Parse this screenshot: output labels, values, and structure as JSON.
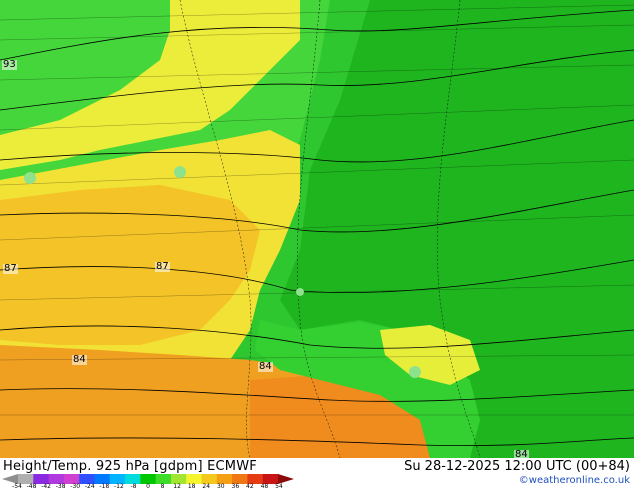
{
  "map": {
    "contour_labels": [
      "93",
      "87",
      "87",
      "84",
      "84",
      "84"
    ]
  },
  "footer": {
    "title_left": "Height/Temp. 925 hPa [gdpm] ECMWF",
    "title_right": "Su 28-12-2025 12:00 UTC (00+84)",
    "credit": "©weatheronline.co.uk"
  },
  "scale": {
    "ticks": [
      "-54",
      "-48",
      "-42",
      "-38",
      "-30",
      "-24",
      "-18",
      "-12",
      "-8",
      "0",
      "8",
      "12",
      "18",
      "24",
      "30",
      "36",
      "42",
      "48",
      "54"
    ],
    "colors": [
      "#8e8e8e",
      "#b0b0b0",
      "#8a2be2",
      "#b03adf",
      "#d040d0",
      "#3050ff",
      "#0078ff",
      "#00b4ff",
      "#00dcdc",
      "#00c800",
      "#3cdc28",
      "#a0e632",
      "#f5f52d",
      "#f5c81e",
      "#f5a014",
      "#f07814",
      "#e63c14",
      "#c81414",
      "#8c0a0a"
    ]
  }
}
